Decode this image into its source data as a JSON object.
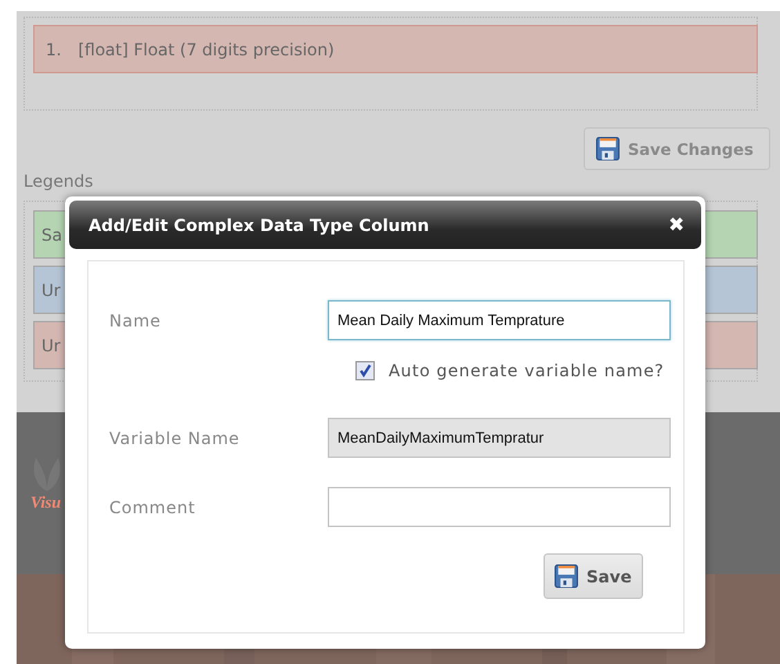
{
  "data_types": [
    {
      "number": "1.",
      "text": "[float] Float (7 digits precision)"
    }
  ],
  "save_changes_button": {
    "label": "Save Changes",
    "disabled": true
  },
  "legends": {
    "heading": "Legends",
    "items": [
      {
        "text": "Sa",
        "color": "#b5d5b2"
      },
      {
        "text": "Ur",
        "color": "#b5c5d6"
      },
      {
        "text": "Ur",
        "color": "#d5b7b2"
      }
    ]
  },
  "footer": {
    "logo_text": "Visu"
  },
  "dialog": {
    "title": "Add/Edit Complex Data Type Column",
    "close": "✖",
    "fields": [
      {
        "kind": "text",
        "label": "Name",
        "value": "Mean Daily Maximum Temprature",
        "focused": true
      },
      {
        "kind": "checkbox",
        "label": "Auto generate variable name?",
        "checked": true
      },
      {
        "kind": "readonly",
        "label": "Variable Name",
        "value": "MeanDailyMaximumTempratur"
      },
      {
        "kind": "text",
        "label": "Comment",
        "focused": false
      }
    ],
    "save_button": {
      "label": "Save"
    }
  }
}
